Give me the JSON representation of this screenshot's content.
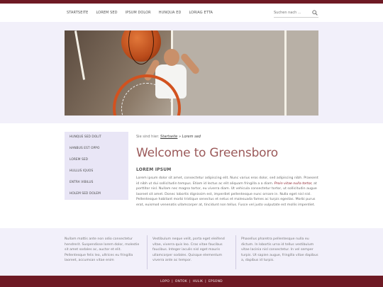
{
  "nav": {
    "items": [
      "Startseite",
      "Lorem sed",
      "Ipsum dolor",
      "Hunqua ed",
      "Loriag etta"
    ]
  },
  "search": {
    "placeholder": "Suchen nach ..."
  },
  "sidebar": {
    "items": [
      {
        "label": "Hunque sed dolit"
      },
      {
        "label": "Hanbus est oppo"
      },
      {
        "label": "Lorem sed"
      },
      {
        "label": "Hullus iquos"
      },
      {
        "label": "Entra vibilus"
      },
      {
        "label": "Holem sed dolem"
      }
    ]
  },
  "breadcrumb": {
    "prefix": "Sie sind hier:",
    "home": "Startseite",
    "separator": "»",
    "current": "Lorem sed"
  },
  "main": {
    "title": "Welcome to Greensboro",
    "subhead": "Lorem ipsum",
    "para_start": "Lorem ipsum dolor sit amet, consectetur adipiscing elit. Nunc varius eros dolor, sed adipiscing nibh. Praesent id nibh ut dui sollicitudin tempus. Etiam id lectus ac elit aliquam fringilla a a diam.",
    "para_accent": "Proin vitae nulla tortor,",
    "para_end": "at porttitor nisl. Nullam nec magna tortor, eu viverra diam. Ut vehicula consectetur tortor, ut sollicitudin augue laoreet sit amet. Donec lobortis dignissim est, imperdiet pellentesque nunc ornare in. Nulla eget nisl nisl. Pellentesque habitant morbi tristique senectus et netus et malesuada fames ac turpis egestas. Morbi purus erat, euismod venenatis ullamcorper at, tincidunt non tellus. Fusce vel justo vulputate est mollis imperdiet."
  },
  "footer": {
    "col1": "Nullam mattis ante non odio consectetur hendrerit. Suspendisse lorem dolor, molestie sit amet sodales ac, auctor et elit. Pellentesque felis leo, ultrices eu fringilla laoreet, accumsan vitae enim",
    "col2": "Vestibulum neque velit, porta eget eleifend vitae, viverra quis leo. Cras vitae faucibus faucibus. Integer iaculis nisl eget mauris ullamcorper sodales. Quisque elementum viverra ante ac tempor.",
    "col3": "Phasellus pharetra pellentesque nulla eu dictum. In lobortis urna id tellus vestibulum vitae lacinia nisl consectetur. In vel semper turpis. Ut sapien augue, fringilla vitae dapibus a, dapibus id turpis."
  },
  "bottom_links": [
    "Lopo",
    "Ontok",
    "Hulik",
    "Epsond"
  ],
  "colors": {
    "brand": "#6e1a24",
    "band": "#f2f0fa",
    "title": "#9b5a5a"
  },
  "icons": {
    "search": "magnifier-icon"
  }
}
